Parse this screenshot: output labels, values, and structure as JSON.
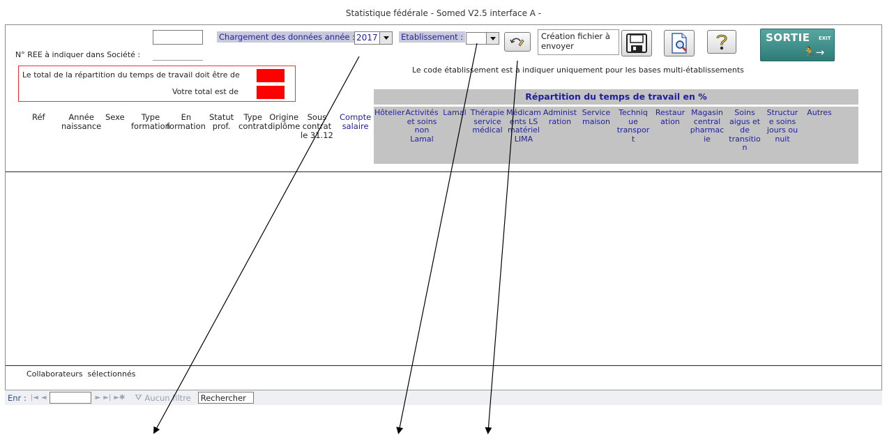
{
  "window": {
    "title": "Statistique fédérale - Somed V2.5 interface A -"
  },
  "header": {
    "ree_label": "N° REE à indiquer dans Société :",
    "ree_value": "",
    "year_label": "Chargement des données année :",
    "year_value": "2017",
    "etab_label": "Etablissement :",
    "etab_value": "",
    "create_file_label": "Création fichier à envoyer",
    "exit_label": "SORTIE",
    "exit_sublabel": "EXIT",
    "etab_note": "Le code établissement est à indiquer uniquement pour les bases multi-établissements"
  },
  "total_box": {
    "must_be_label": "Le total de la répartition du temps de travail doit être de",
    "your_total_label": "Votre total est de",
    "alert_color": "#ff0000"
  },
  "columns": [
    "Réf",
    "Année\nnaissance",
    "Sexe",
    "Type\nformation",
    "En\nformation",
    "Statut\nprof.",
    "Type\ncontrat",
    "Origine\ndiplôme",
    "Sous\ncontrat\nle 31.12",
    "Compte\nsalaire"
  ],
  "repartition": {
    "title": "Répartition du temps de travail en %",
    "columns": [
      "Hôtelier",
      "Activités\net soins\nnon\nLamal",
      "Lamal",
      "Thérapie\nservice\nmédical",
      "Médicam\nents LS\nmatériel\nLIMA",
      "Administ\nration",
      "Service\nmaison",
      "Techniq\nue\ntranspor\nt",
      "Restaur\nation",
      "Magasin\ncentral\npharmac\nie",
      "Soins\naigus et\nde\ntransitio\nn",
      "Structur\ne soins\njours ou\nnuit",
      "Autres"
    ]
  },
  "footer": {
    "selected_label": "Collaborateurs  sélectionnés"
  },
  "nav": {
    "record_label": "Enr :",
    "record_value": "",
    "filter_label": "Aucun filtre",
    "search_label": "Rechercher"
  },
  "colors": {
    "label_blue": "#1f1f9c",
    "header_gray": "#c3c3c3",
    "exit_teal": "#3f8f8a"
  }
}
